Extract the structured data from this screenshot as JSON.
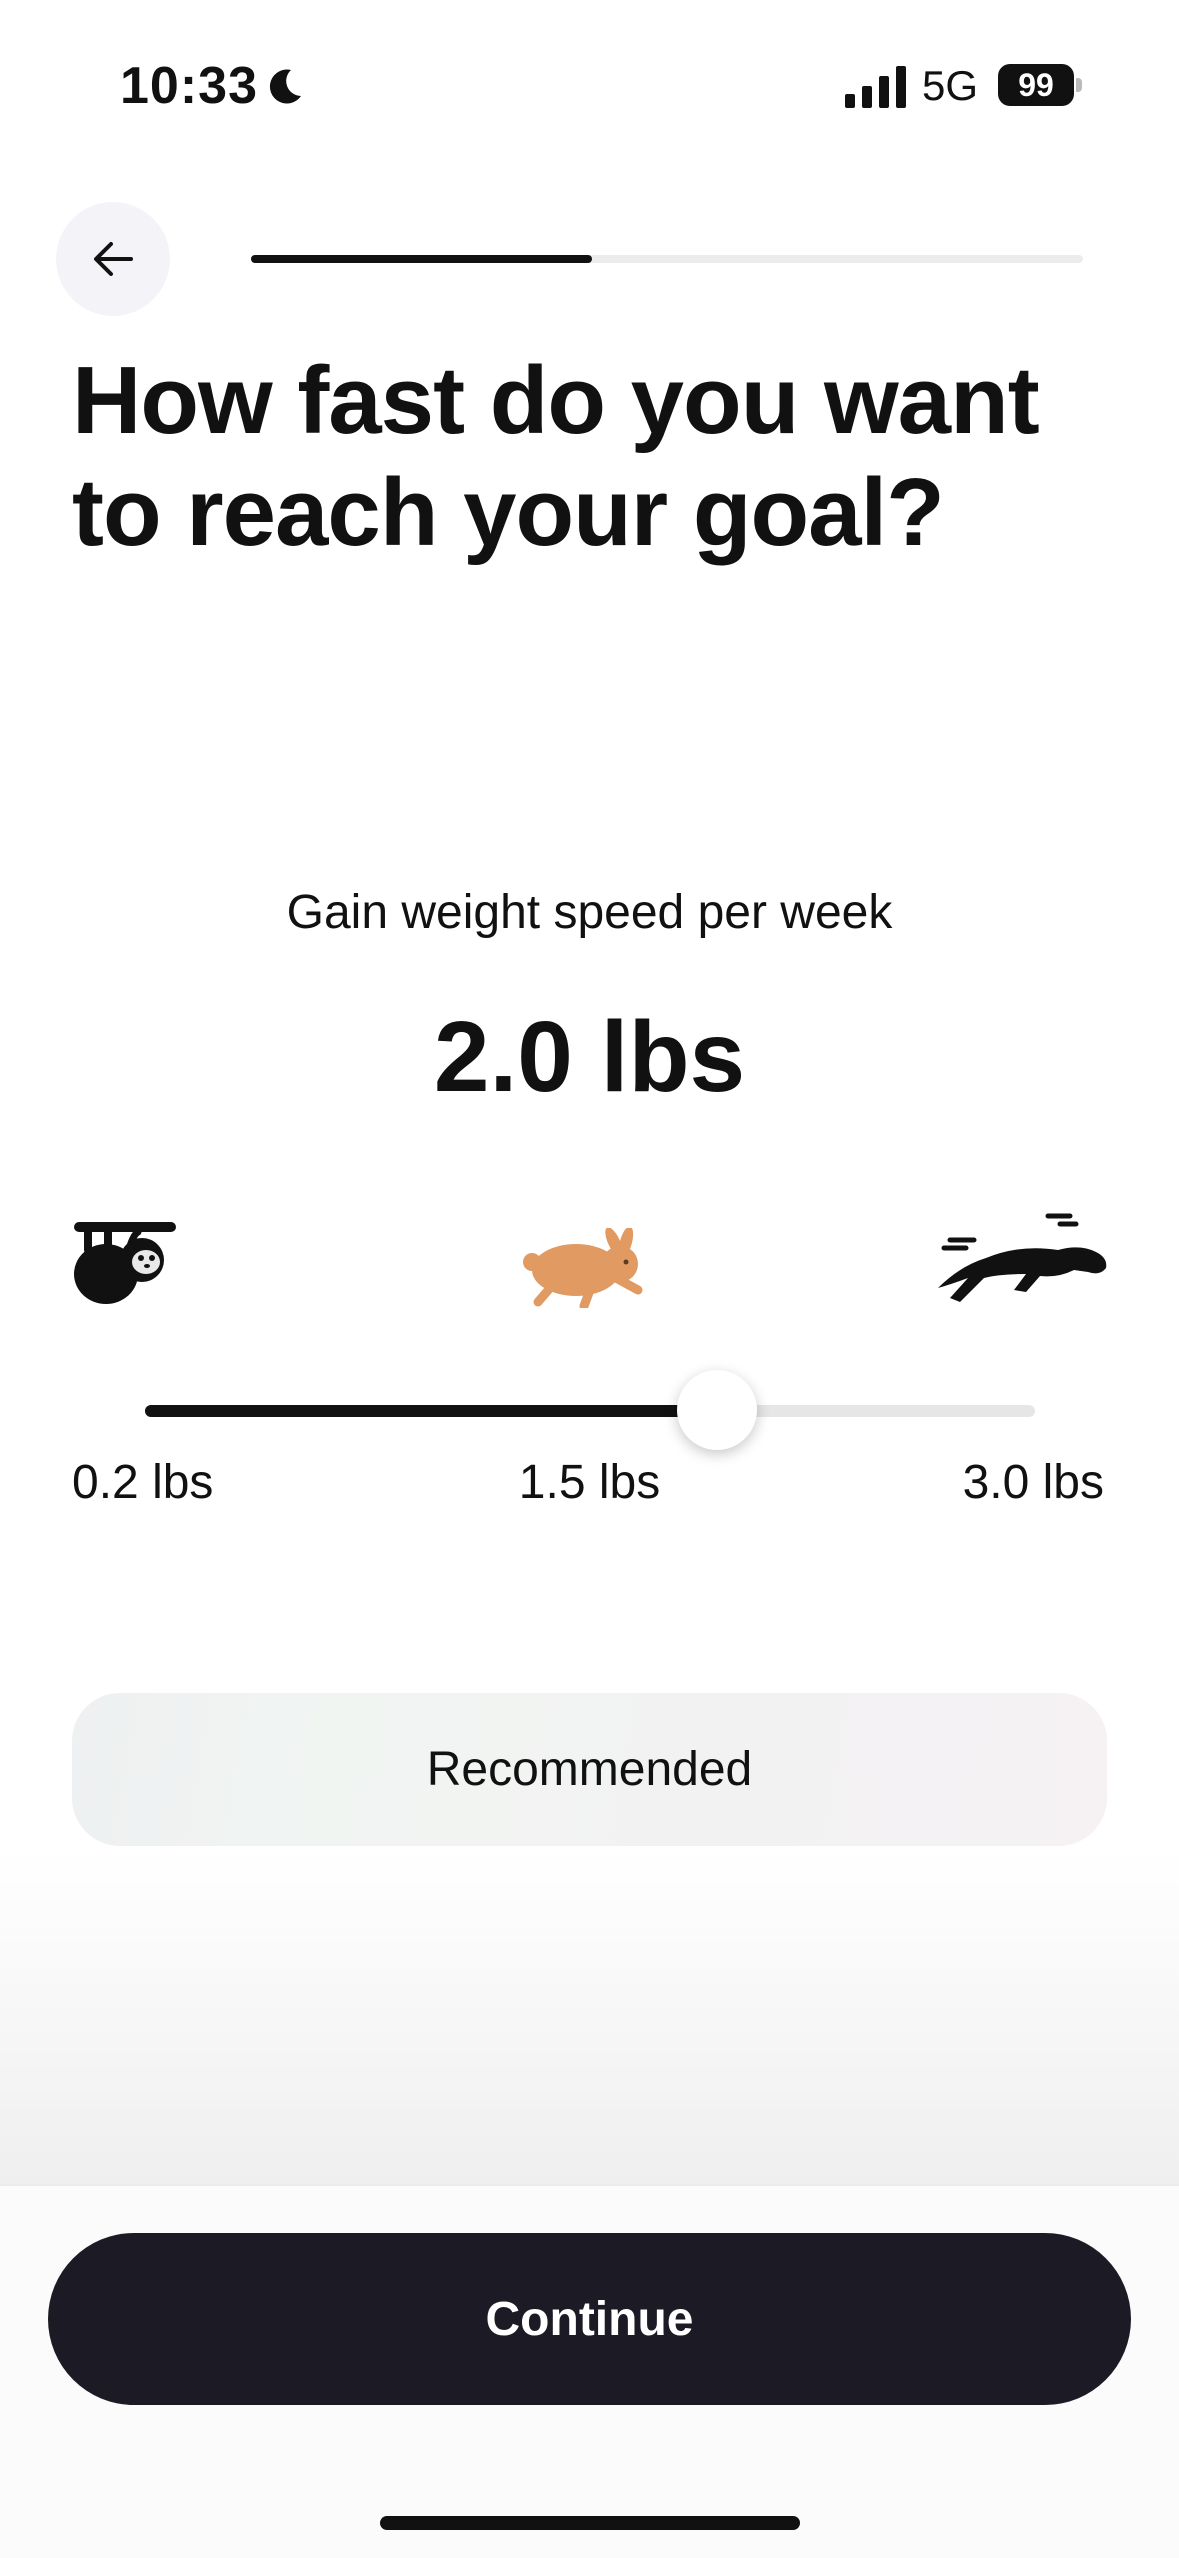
{
  "status_bar": {
    "time": "10:33",
    "network": "5G",
    "battery": "99"
  },
  "onboarding": {
    "progress": 0.41
  },
  "title": "How fast do you want to reach your goal?",
  "speed": {
    "label": "Gain weight speed per week",
    "value": "2.0 lbs",
    "icons": [
      "sloth-icon",
      "rabbit-icon",
      "panther-icon"
    ],
    "rabbit_color": "#e09a62"
  },
  "slider": {
    "min_label": "0.2 lbs",
    "mid_label": "1.5 lbs",
    "max_label": "3.0 lbs",
    "min": 0.2,
    "max": 3.0,
    "value": 2.0
  },
  "recommendation": {
    "label": "Recommended"
  },
  "continue": {
    "label": "Continue"
  }
}
